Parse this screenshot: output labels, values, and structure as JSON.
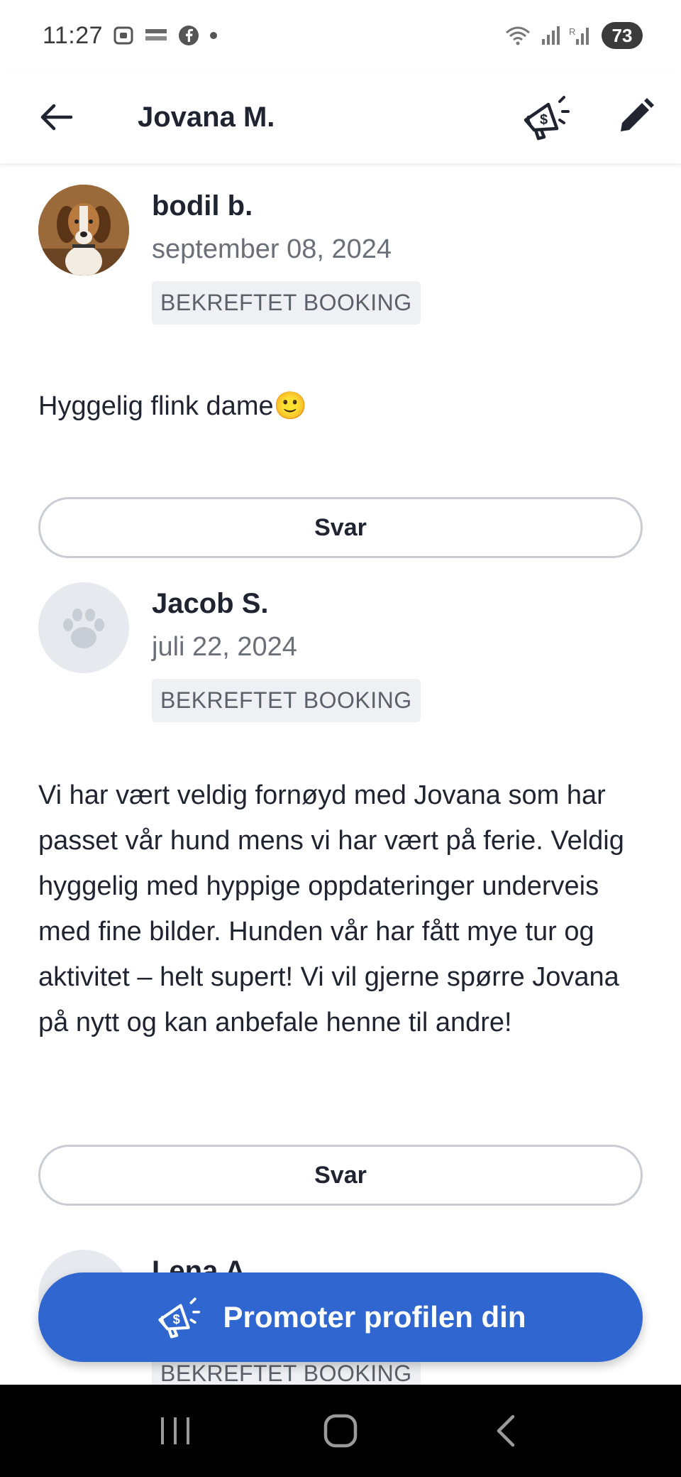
{
  "status_bar": {
    "time": "11:27",
    "notification_icons": [
      "screenshot-icon",
      "temu-icon",
      "facebook-icon",
      "dot-icon"
    ],
    "battery": "73"
  },
  "app_bar": {
    "title": "Jovana M."
  },
  "reviews": [
    {
      "name": "bodil b.",
      "date": "september 08, 2024",
      "badge": "BEKREFTET BOOKING",
      "text": "Hyggelig flink dame🙂",
      "reply_label": "Svar",
      "avatar": "dog-photo"
    },
    {
      "name": "Jacob S.",
      "date": "juli 22, 2024",
      "badge": "BEKREFTET BOOKING",
      "text": "Vi har vært veldig fornøyd med Jovana som har passet vår hund mens vi har vært på ferie. Veldig hyggelig med hyppige oppdateringer underveis med fine bilder. Hunden vår har fått mye tur og aktivitet – helt supert! Vi vil gjerne spørre Jovana på nytt og kan anbefale henne til andre!",
      "reply_label": "Svar",
      "avatar": "paw-placeholder"
    },
    {
      "name": "Lena A.",
      "badge": "BEKREFTET BOOKING",
      "avatar": "paw-placeholder"
    }
  ],
  "promote_button": {
    "label": "Promoter profilen din"
  },
  "colors": {
    "accent": "#2f66d0",
    "badge_bg": "#eef0f3",
    "text": "#1f2430",
    "muted": "#6b6f78"
  }
}
